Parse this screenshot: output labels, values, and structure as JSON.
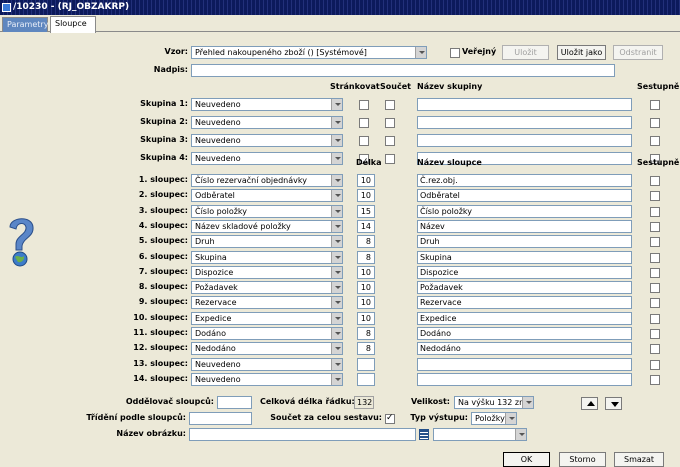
{
  "window": {
    "title": "/10230 - (RJ_OBZAKRP)"
  },
  "tabs": [
    "Parametry",
    "Sloupce"
  ],
  "vzor": {
    "label": "Vzor:",
    "value": "Přehled nakoupeného zboží  ()  [Systémové]",
    "public_label": "Veřejný",
    "save": "Uložit",
    "save_as": "Uložit jako",
    "remove": "Odstranit"
  },
  "nadpis": {
    "label": "Nadpis:",
    "value": ""
  },
  "group_headers": {
    "strankovat": "Stránkovat",
    "soucet": "Součet",
    "nazev": "Název skupiny",
    "sestupne": "Sestupně"
  },
  "groups": [
    {
      "label": "Skupina 1:",
      "value": "Neuvedeno"
    },
    {
      "label": "Skupina 2:",
      "value": "Neuvedeno"
    },
    {
      "label": "Skupina 3:",
      "value": "Neuvedeno"
    },
    {
      "label": "Skupina 4:",
      "value": "Neuvedeno"
    }
  ],
  "column_headers": {
    "delka": "Délka",
    "nazev": "Název sloupce",
    "sestupne": "Sestupně"
  },
  "columns": [
    {
      "label": "1. sloupec:",
      "value": "Číslo rezervační objednávky",
      "len": "10",
      "name": "Č.rez.obj."
    },
    {
      "label": "2. sloupec:",
      "value": "Odběratel",
      "len": "10",
      "name": "Odběratel"
    },
    {
      "label": "3. sloupec:",
      "value": "Číslo položky",
      "len": "15",
      "name": "Číslo položky"
    },
    {
      "label": "4. sloupec:",
      "value": "Název skladové položky",
      "len": "14",
      "name": "Název"
    },
    {
      "label": "5. sloupec:",
      "value": "Druh",
      "len": "8",
      "name": "Druh"
    },
    {
      "label": "6. sloupec:",
      "value": "Skupina",
      "len": "8",
      "name": "Skupina"
    },
    {
      "label": "7. sloupec:",
      "value": "Dispozice",
      "len": "10",
      "name": "Dispozice"
    },
    {
      "label": "8. sloupec:",
      "value": "Požadavek",
      "len": "10",
      "name": "Požadavek"
    },
    {
      "label": "9. sloupec:",
      "value": "Rezervace",
      "len": "10",
      "name": "Rezervace"
    },
    {
      "label": "10. sloupec:",
      "value": "Expedice",
      "len": "10",
      "name": "Expedice"
    },
    {
      "label": "11. sloupec:",
      "value": "Dodáno",
      "len": "8",
      "name": "Dodáno"
    },
    {
      "label": "12. sloupec:",
      "value": "Nedodáno",
      "len": "8",
      "name": "Nedodáno"
    },
    {
      "label": "13. sloupec:",
      "value": "Neuvedeno",
      "len": "",
      "name": ""
    },
    {
      "label": "14. sloupec:",
      "value": "Neuvedeno",
      "len": "",
      "name": ""
    }
  ],
  "bottom": {
    "separator_label": "Oddělovač sloupců:",
    "separator_value": "",
    "total_len_label": "Celková délka řádku:",
    "total_len": "132",
    "size_label": "Velikost:",
    "size_value": "Na výšku 132 zn.",
    "sort_label": "Třídění podle sloupců:",
    "sort_value": "",
    "total_sum_label": "Součet za celou sestavu:",
    "output_label": "Typ výstupu:",
    "output_value": "Položky",
    "image_label": "Název obrázku:",
    "image_value": ""
  },
  "buttons": {
    "ok": "OK",
    "storno": "Storno",
    "smazat": "Smazat"
  }
}
